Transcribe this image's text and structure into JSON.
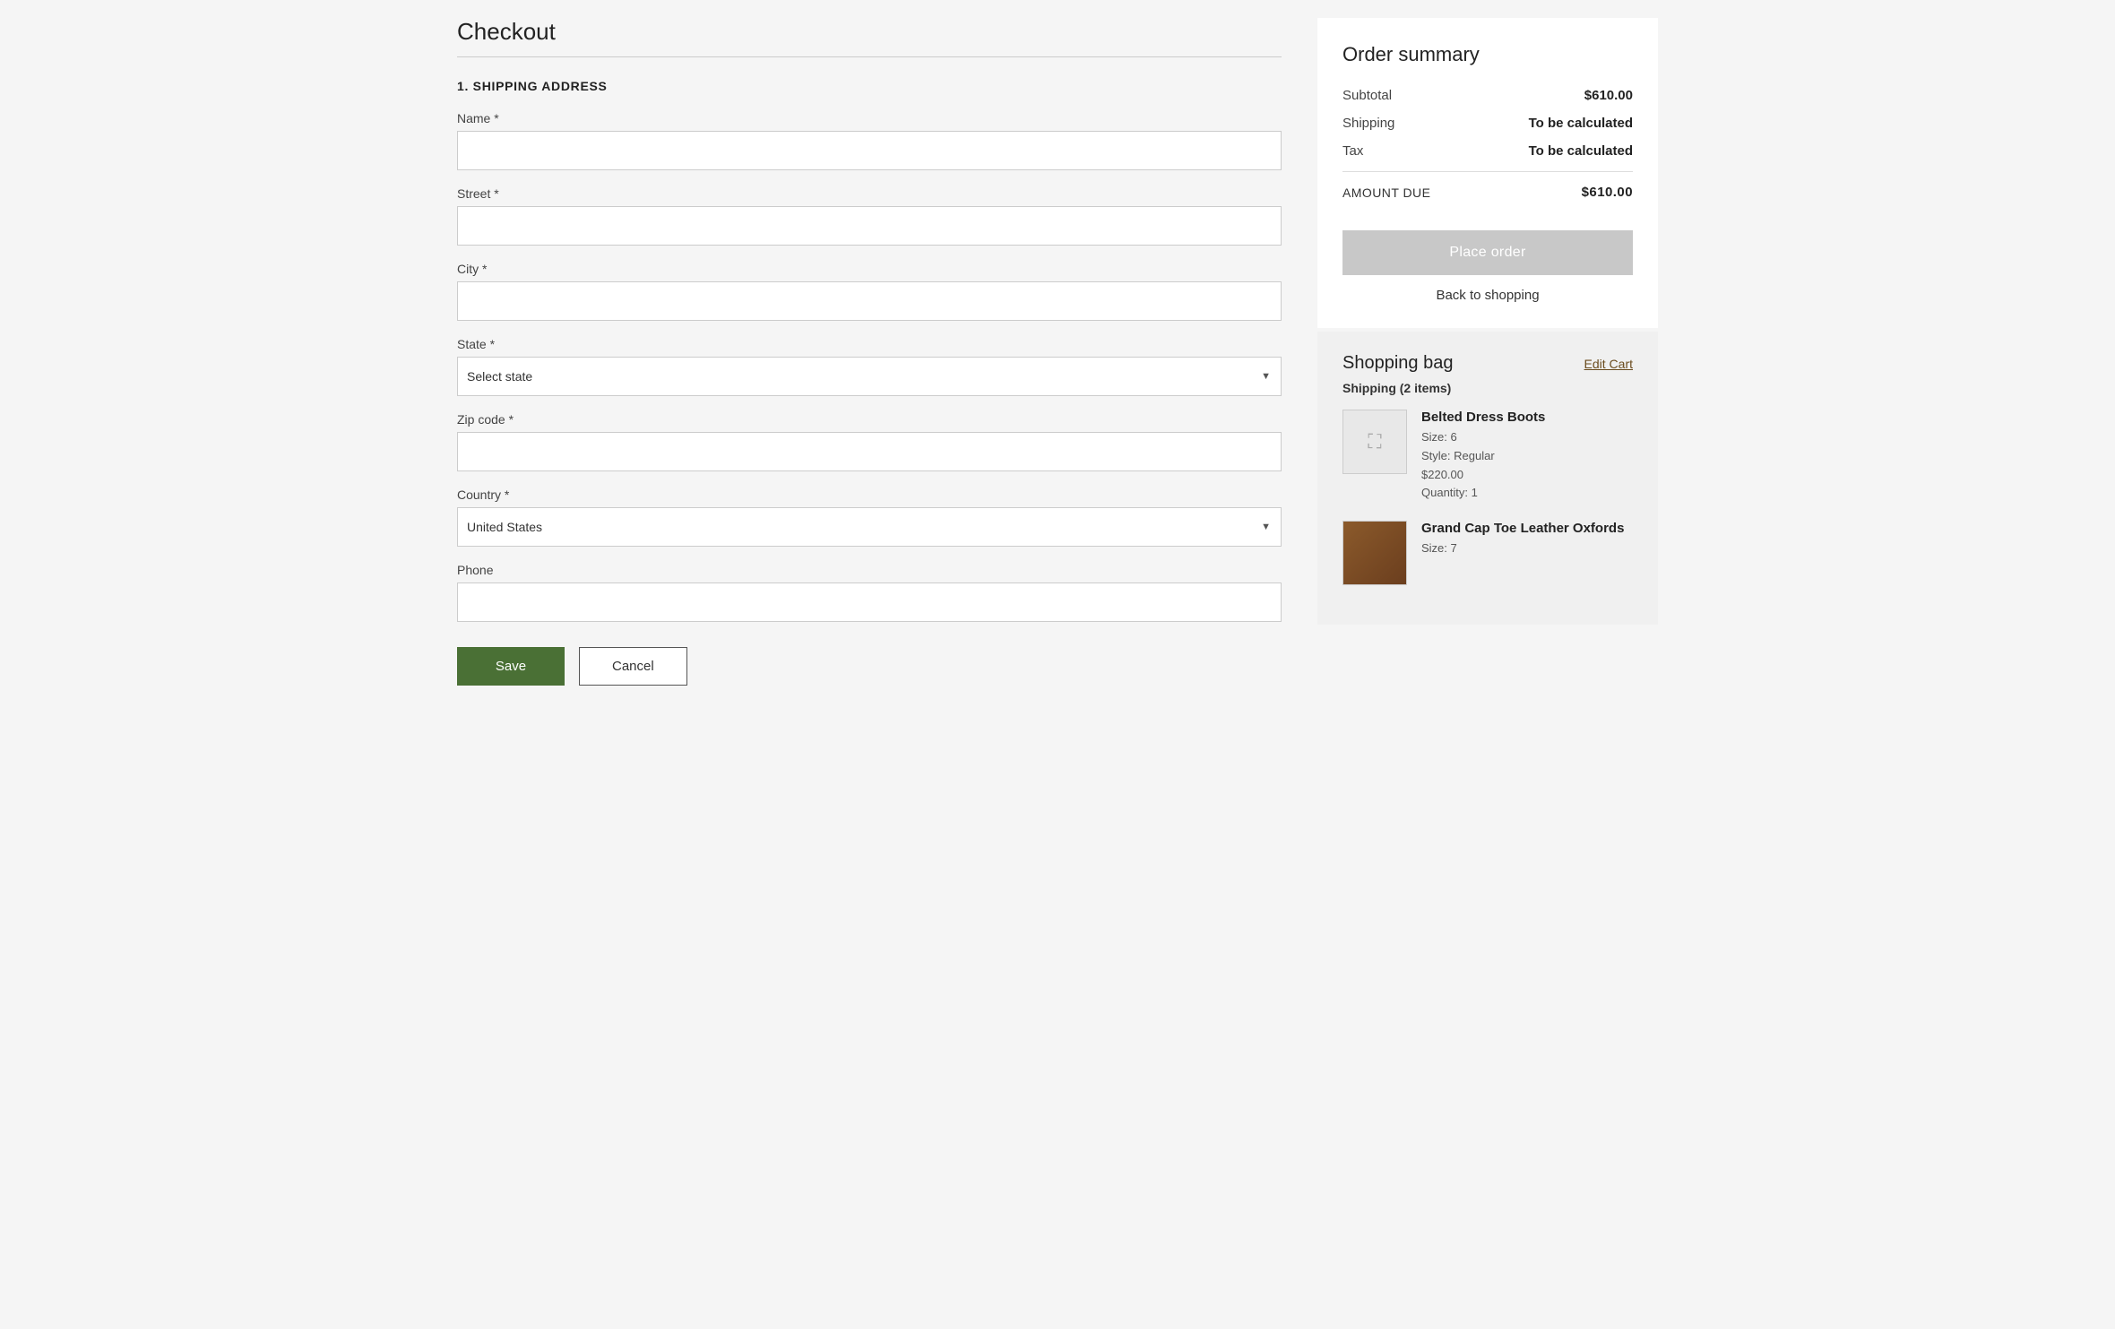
{
  "page": {
    "title": "Checkout"
  },
  "shipping_address": {
    "section_title": "1. SHIPPING ADDRESS",
    "name_label": "Name *",
    "street_label": "Street *",
    "city_label": "City *",
    "state_label": "State *",
    "state_placeholder": "Select state",
    "zipcode_label": "Zip code *",
    "country_label": "Country *",
    "country_value": "United States",
    "phone_label": "Phone",
    "save_button": "Save",
    "cancel_button": "Cancel"
  },
  "order_summary": {
    "title": "Order summary",
    "subtotal_label": "Subtotal",
    "subtotal_value": "$610.00",
    "shipping_label": "Shipping",
    "shipping_value": "To be calculated",
    "tax_label": "Tax",
    "tax_value": "To be calculated",
    "amount_due_label": "AMOUNT DUE",
    "amount_due_value": "$610.00",
    "place_order_button": "Place order",
    "back_to_shopping": "Back to shopping"
  },
  "shopping_bag": {
    "title": "Shopping bag",
    "edit_cart_link": "Edit Cart",
    "shipping_label": "Shipping (2 items)",
    "items": [
      {
        "name": "Belted Dress Boots",
        "size": "Size: 6",
        "style": "Style: Regular",
        "price": "$220.00",
        "quantity": "Quantity: 1",
        "has_image": false
      },
      {
        "name": "Grand Cap Toe Leather Oxfords",
        "size": "Size: 7",
        "has_image": true
      }
    ]
  }
}
